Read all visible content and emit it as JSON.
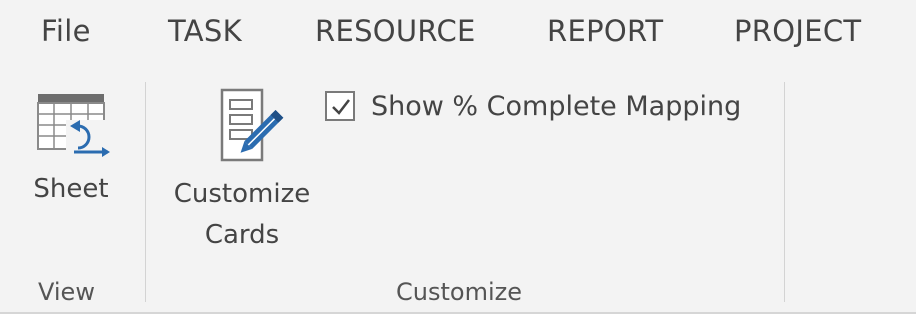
{
  "tabs": [
    {
      "label": "File"
    },
    {
      "label": "TASK"
    },
    {
      "label": "RESOURCE"
    },
    {
      "label": "REPORT"
    },
    {
      "label": "PROJECT"
    }
  ],
  "groups": {
    "view": {
      "label": "View",
      "sheet_button": {
        "label": "Sheet",
        "icon": "sheet-view-icon"
      }
    },
    "customize": {
      "label": "Customize",
      "customize_cards_button": {
        "label_line1": "Customize",
        "label_line2": "Cards",
        "icon": "customize-cards-icon"
      },
      "show_complete_mapping": {
        "label": "Show % Complete Mapping",
        "checked": true
      }
    }
  },
  "colors": {
    "background": "#f3f3f3",
    "text": "#444444",
    "icon_blue": "#2b6cb0",
    "separator": "#d3d3d3"
  }
}
